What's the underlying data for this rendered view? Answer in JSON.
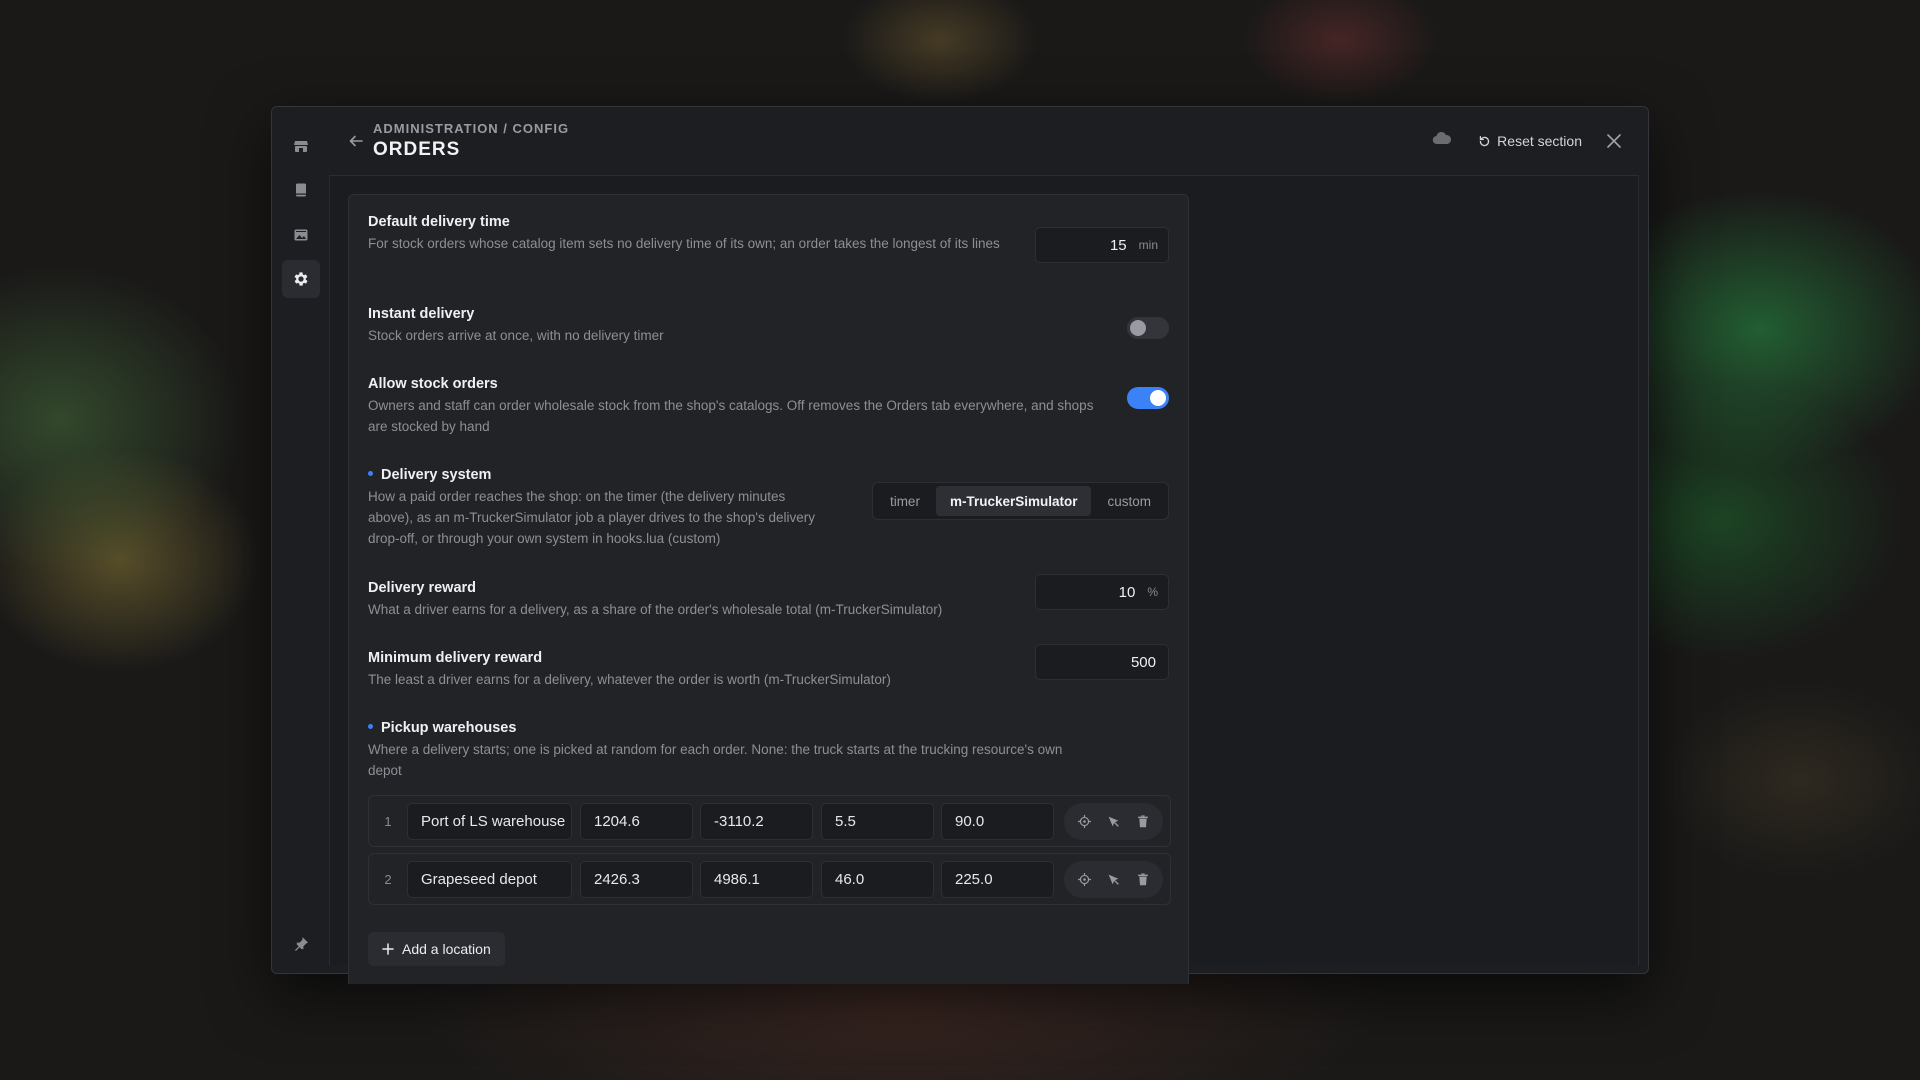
{
  "header": {
    "breadcrumb": "ADMINISTRATION / CONFIG",
    "title": "ORDERS",
    "reset_label": "Reset section"
  },
  "rail": {
    "icons": [
      "shop-icon",
      "book-icon",
      "image-icon",
      "gear-icon"
    ],
    "active": "gear-icon",
    "bottom_icon": "pin-icon"
  },
  "settings": {
    "default_delivery_time": {
      "label": "Default delivery time",
      "description": "For stock orders whose catalog item sets no delivery time of its own; an order takes the longest of its lines",
      "value": "15",
      "unit": "min"
    },
    "instant_delivery": {
      "label": "Instant delivery",
      "description": "Stock orders arrive at once, with no delivery timer",
      "enabled": false
    },
    "allow_stock_orders": {
      "label": "Allow stock orders",
      "description": "Owners and staff can order wholesale stock from the shop's catalogs. Off removes the Orders tab everywhere, and shops are stocked by hand",
      "enabled": true
    },
    "delivery_system": {
      "label": "Delivery system",
      "description": "How a paid order reaches the shop: on the timer (the delivery minutes above), as an m-TruckerSimulator job a player drives to the shop's delivery drop-off, or through your own system in hooks.lua (custom)",
      "options": [
        "timer",
        "m-TruckerSimulator",
        "custom"
      ],
      "selected": "m-TruckerSimulator"
    },
    "delivery_reward": {
      "label": "Delivery reward",
      "description": "What a driver earns for a delivery, as a share of the order's wholesale total (m-TruckerSimulator)",
      "value": "10",
      "unit": "%"
    },
    "minimum_delivery_reward": {
      "label": "Minimum delivery reward",
      "description": "The least a driver earns for a delivery, whatever the order is worth (m-TruckerSimulator)",
      "value": "500"
    },
    "pickup_warehouses": {
      "label": "Pickup warehouses",
      "description": "Where a delivery starts; one is picked at random for each order. None: the truck starts at the trucking resource's own depot",
      "rows": [
        {
          "index": "1",
          "name": "Port of LS warehouse",
          "x": "1204.6",
          "y": "-3110.2",
          "z": "5.5",
          "heading": "90.0"
        },
        {
          "index": "2",
          "name": "Grapeseed depot",
          "x": "2426.3",
          "y": "4986.1",
          "z": "46.0",
          "heading": "225.0"
        }
      ],
      "add_label": "Add a location"
    }
  },
  "colors": {
    "accent": "#3b82f6",
    "modal_bg": "#1d1e22",
    "panel_bg": "#222327"
  }
}
